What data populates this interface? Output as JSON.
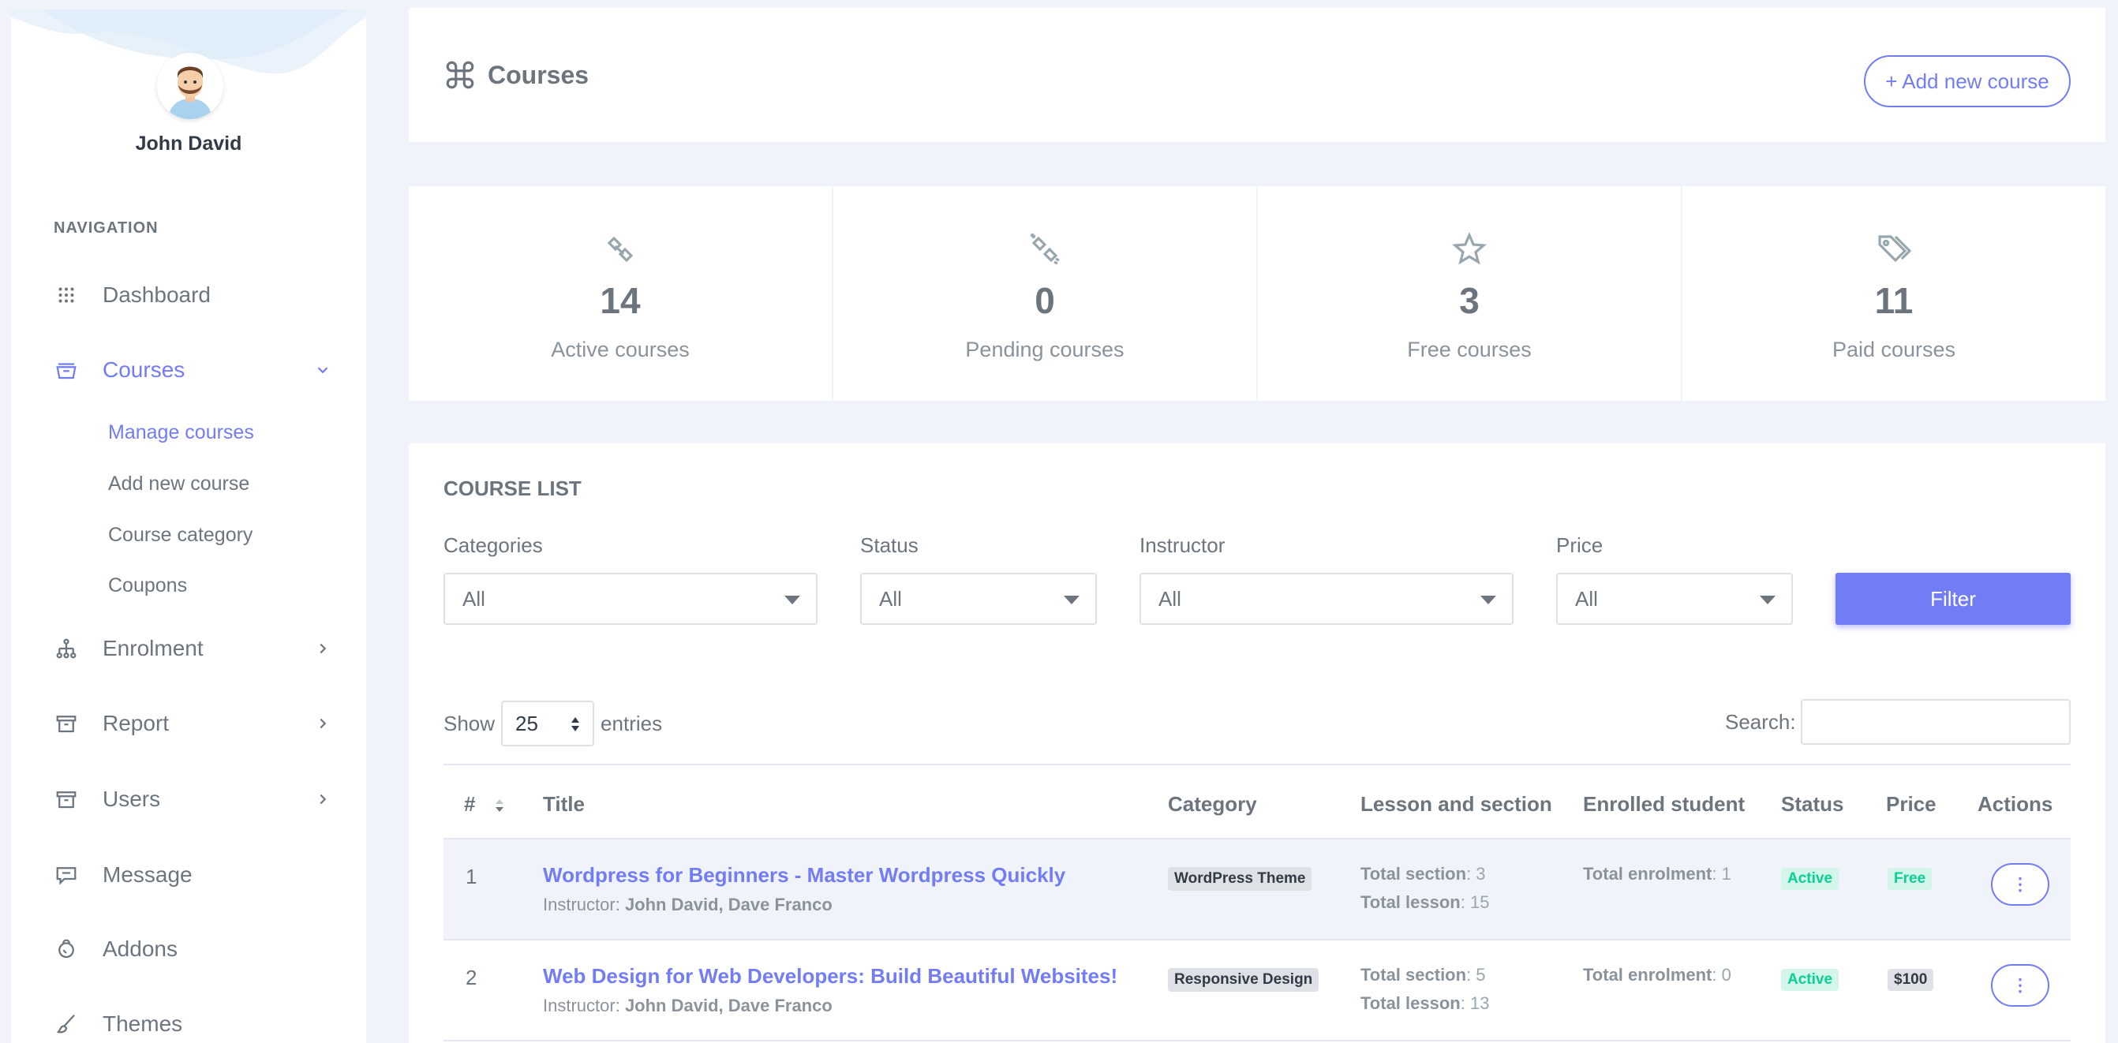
{
  "user": {
    "name": "John David"
  },
  "nav": {
    "title": "NAVIGATION",
    "items": [
      {
        "label": "Dashboard",
        "icon": "grid-icon"
      },
      {
        "label": "Courses",
        "icon": "archive-icon"
      },
      {
        "label": "Enrolment",
        "icon": "sitemap-icon"
      },
      {
        "label": "Report",
        "icon": "box-icon"
      },
      {
        "label": "Users",
        "icon": "box-icon"
      },
      {
        "label": "Message",
        "icon": "message-icon"
      },
      {
        "label": "Addons",
        "icon": "addons-icon"
      },
      {
        "label": "Themes",
        "icon": "brush-icon"
      }
    ],
    "sub_items": [
      "Manage courses",
      "Add new course",
      "Course category",
      "Coupons"
    ]
  },
  "header": {
    "title": "Courses",
    "add_button": "+ Add new course"
  },
  "stats": [
    {
      "value": "14",
      "label": "Active courses",
      "icon": "link-icon"
    },
    {
      "value": "0",
      "label": "Pending courses",
      "icon": "broken-link-icon"
    },
    {
      "value": "3",
      "label": "Free courses",
      "icon": "star-icon"
    },
    {
      "value": "11",
      "label": "Paid courses",
      "icon": "tags-icon"
    }
  ],
  "list": {
    "title": "COURSE LIST",
    "filters": [
      {
        "label": "Categories",
        "value": "All"
      },
      {
        "label": "Status",
        "value": "All"
      },
      {
        "label": "Instructor",
        "value": "All"
      },
      {
        "label": "Price",
        "value": "All"
      }
    ],
    "filter_button": "Filter",
    "show_label": "Show",
    "entries_value": "25",
    "entries_label": "entries",
    "search_label": "Search:",
    "columns": [
      "#",
      "Title",
      "Category",
      "Lesson and section",
      "Enrolled student",
      "Status",
      "Price",
      "Actions"
    ],
    "rows": [
      {
        "num": "1",
        "title": "Wordpress for Beginners - Master Wordpress Quickly",
        "instructor_label": "Instructor:",
        "instructors": "John David, Dave Franco",
        "category": "WordPress Theme",
        "section_label": "Total section",
        "section_value": ": 3",
        "lesson_label": "Total lesson",
        "lesson_value": ": 15",
        "enrol_label": "Total enrolment",
        "enrol_value": ": 1",
        "status": "Active",
        "price": "Free",
        "action": "⋮"
      },
      {
        "num": "2",
        "title": "Web Design for Web Developers: Build Beautiful Websites!",
        "instructor_label": "Instructor:",
        "instructors": "John David, Dave Franco",
        "category": "Responsive Design",
        "section_label": "Total section",
        "section_value": ": 5",
        "lesson_label": "Total lesson",
        "lesson_value": ": 13",
        "enrol_label": "Total enrolment",
        "enrol_value": ": 0",
        "status": "Active",
        "price": "$100",
        "action": "⋮"
      }
    ]
  },
  "colors": {
    "accent": "#727cf5",
    "success": "#0acf97",
    "text": "#6c757d",
    "background": "#f1f3fa"
  }
}
